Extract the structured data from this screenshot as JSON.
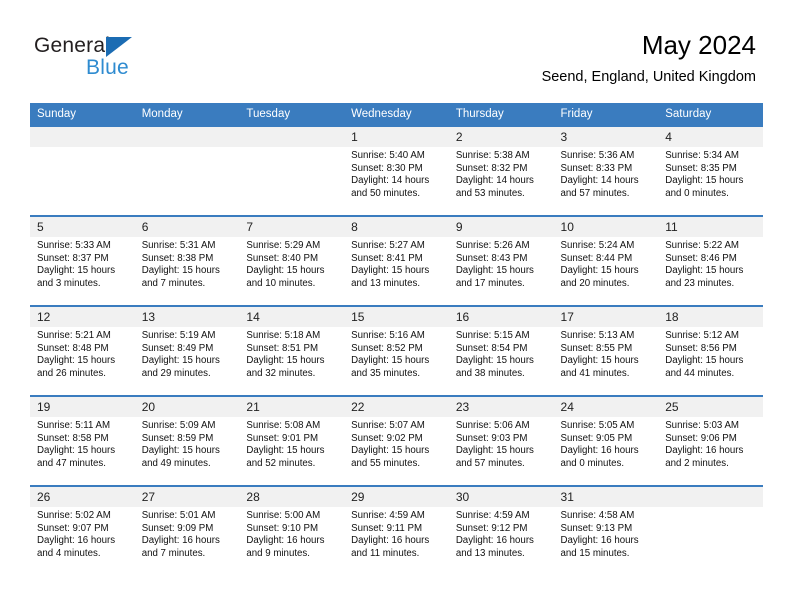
{
  "brand": {
    "name_dark": "General",
    "name_blue": "Blue",
    "accent_blue": "#2e8bd0",
    "triangle_blue": "#1b6cb3"
  },
  "header": {
    "title": "May 2024",
    "subtitle": "Seend, England, United Kingdom"
  },
  "colors": {
    "header_row_bg": "#3a7cbf",
    "daynum_bg": "#f1f1f1",
    "page_bg": "#ffffff",
    "text": "#000000"
  },
  "weekday_headers": [
    "Sunday",
    "Monday",
    "Tuesday",
    "Wednesday",
    "Thursday",
    "Friday",
    "Saturday"
  ],
  "weeks": [
    {
      "days": [
        {
          "num": "",
          "empty": true,
          "sunrise": "",
          "sunset": "",
          "daylight_1": "",
          "daylight_2": ""
        },
        {
          "num": "",
          "empty": true,
          "sunrise": "",
          "sunset": "",
          "daylight_1": "",
          "daylight_2": ""
        },
        {
          "num": "",
          "empty": true,
          "sunrise": "",
          "sunset": "",
          "daylight_1": "",
          "daylight_2": ""
        },
        {
          "num": "1",
          "empty": false,
          "sunrise": "Sunrise: 5:40 AM",
          "sunset": "Sunset: 8:30 PM",
          "daylight_1": "Daylight: 14 hours",
          "daylight_2": "and 50 minutes."
        },
        {
          "num": "2",
          "empty": false,
          "sunrise": "Sunrise: 5:38 AM",
          "sunset": "Sunset: 8:32 PM",
          "daylight_1": "Daylight: 14 hours",
          "daylight_2": "and 53 minutes."
        },
        {
          "num": "3",
          "empty": false,
          "sunrise": "Sunrise: 5:36 AM",
          "sunset": "Sunset: 8:33 PM",
          "daylight_1": "Daylight: 14 hours",
          "daylight_2": "and 57 minutes."
        },
        {
          "num": "4",
          "empty": false,
          "sunrise": "Sunrise: 5:34 AM",
          "sunset": "Sunset: 8:35 PM",
          "daylight_1": "Daylight: 15 hours",
          "daylight_2": "and 0 minutes."
        }
      ]
    },
    {
      "days": [
        {
          "num": "5",
          "empty": false,
          "sunrise": "Sunrise: 5:33 AM",
          "sunset": "Sunset: 8:37 PM",
          "daylight_1": "Daylight: 15 hours",
          "daylight_2": "and 3 minutes."
        },
        {
          "num": "6",
          "empty": false,
          "sunrise": "Sunrise: 5:31 AM",
          "sunset": "Sunset: 8:38 PM",
          "daylight_1": "Daylight: 15 hours",
          "daylight_2": "and 7 minutes."
        },
        {
          "num": "7",
          "empty": false,
          "sunrise": "Sunrise: 5:29 AM",
          "sunset": "Sunset: 8:40 PM",
          "daylight_1": "Daylight: 15 hours",
          "daylight_2": "and 10 minutes."
        },
        {
          "num": "8",
          "empty": false,
          "sunrise": "Sunrise: 5:27 AM",
          "sunset": "Sunset: 8:41 PM",
          "daylight_1": "Daylight: 15 hours",
          "daylight_2": "and 13 minutes."
        },
        {
          "num": "9",
          "empty": false,
          "sunrise": "Sunrise: 5:26 AM",
          "sunset": "Sunset: 8:43 PM",
          "daylight_1": "Daylight: 15 hours",
          "daylight_2": "and 17 minutes."
        },
        {
          "num": "10",
          "empty": false,
          "sunrise": "Sunrise: 5:24 AM",
          "sunset": "Sunset: 8:44 PM",
          "daylight_1": "Daylight: 15 hours",
          "daylight_2": "and 20 minutes."
        },
        {
          "num": "11",
          "empty": false,
          "sunrise": "Sunrise: 5:22 AM",
          "sunset": "Sunset: 8:46 PM",
          "daylight_1": "Daylight: 15 hours",
          "daylight_2": "and 23 minutes."
        }
      ]
    },
    {
      "days": [
        {
          "num": "12",
          "empty": false,
          "sunrise": "Sunrise: 5:21 AM",
          "sunset": "Sunset: 8:48 PM",
          "daylight_1": "Daylight: 15 hours",
          "daylight_2": "and 26 minutes."
        },
        {
          "num": "13",
          "empty": false,
          "sunrise": "Sunrise: 5:19 AM",
          "sunset": "Sunset: 8:49 PM",
          "daylight_1": "Daylight: 15 hours",
          "daylight_2": "and 29 minutes."
        },
        {
          "num": "14",
          "empty": false,
          "sunrise": "Sunrise: 5:18 AM",
          "sunset": "Sunset: 8:51 PM",
          "daylight_1": "Daylight: 15 hours",
          "daylight_2": "and 32 minutes."
        },
        {
          "num": "15",
          "empty": false,
          "sunrise": "Sunrise: 5:16 AM",
          "sunset": "Sunset: 8:52 PM",
          "daylight_1": "Daylight: 15 hours",
          "daylight_2": "and 35 minutes."
        },
        {
          "num": "16",
          "empty": false,
          "sunrise": "Sunrise: 5:15 AM",
          "sunset": "Sunset: 8:54 PM",
          "daylight_1": "Daylight: 15 hours",
          "daylight_2": "and 38 minutes."
        },
        {
          "num": "17",
          "empty": false,
          "sunrise": "Sunrise: 5:13 AM",
          "sunset": "Sunset: 8:55 PM",
          "daylight_1": "Daylight: 15 hours",
          "daylight_2": "and 41 minutes."
        },
        {
          "num": "18",
          "empty": false,
          "sunrise": "Sunrise: 5:12 AM",
          "sunset": "Sunset: 8:56 PM",
          "daylight_1": "Daylight: 15 hours",
          "daylight_2": "and 44 minutes."
        }
      ]
    },
    {
      "days": [
        {
          "num": "19",
          "empty": false,
          "sunrise": "Sunrise: 5:11 AM",
          "sunset": "Sunset: 8:58 PM",
          "daylight_1": "Daylight: 15 hours",
          "daylight_2": "and 47 minutes."
        },
        {
          "num": "20",
          "empty": false,
          "sunrise": "Sunrise: 5:09 AM",
          "sunset": "Sunset: 8:59 PM",
          "daylight_1": "Daylight: 15 hours",
          "daylight_2": "and 49 minutes."
        },
        {
          "num": "21",
          "empty": false,
          "sunrise": "Sunrise: 5:08 AM",
          "sunset": "Sunset: 9:01 PM",
          "daylight_1": "Daylight: 15 hours",
          "daylight_2": "and 52 minutes."
        },
        {
          "num": "22",
          "empty": false,
          "sunrise": "Sunrise: 5:07 AM",
          "sunset": "Sunset: 9:02 PM",
          "daylight_1": "Daylight: 15 hours",
          "daylight_2": "and 55 minutes."
        },
        {
          "num": "23",
          "empty": false,
          "sunrise": "Sunrise: 5:06 AM",
          "sunset": "Sunset: 9:03 PM",
          "daylight_1": "Daylight: 15 hours",
          "daylight_2": "and 57 minutes."
        },
        {
          "num": "24",
          "empty": false,
          "sunrise": "Sunrise: 5:05 AM",
          "sunset": "Sunset: 9:05 PM",
          "daylight_1": "Daylight: 16 hours",
          "daylight_2": "and 0 minutes."
        },
        {
          "num": "25",
          "empty": false,
          "sunrise": "Sunrise: 5:03 AM",
          "sunset": "Sunset: 9:06 PM",
          "daylight_1": "Daylight: 16 hours",
          "daylight_2": "and 2 minutes."
        }
      ]
    },
    {
      "days": [
        {
          "num": "26",
          "empty": false,
          "sunrise": "Sunrise: 5:02 AM",
          "sunset": "Sunset: 9:07 PM",
          "daylight_1": "Daylight: 16 hours",
          "daylight_2": "and 4 minutes."
        },
        {
          "num": "27",
          "empty": false,
          "sunrise": "Sunrise: 5:01 AM",
          "sunset": "Sunset: 9:09 PM",
          "daylight_1": "Daylight: 16 hours",
          "daylight_2": "and 7 minutes."
        },
        {
          "num": "28",
          "empty": false,
          "sunrise": "Sunrise: 5:00 AM",
          "sunset": "Sunset: 9:10 PM",
          "daylight_1": "Daylight: 16 hours",
          "daylight_2": "and 9 minutes."
        },
        {
          "num": "29",
          "empty": false,
          "sunrise": "Sunrise: 4:59 AM",
          "sunset": "Sunset: 9:11 PM",
          "daylight_1": "Daylight: 16 hours",
          "daylight_2": "and 11 minutes."
        },
        {
          "num": "30",
          "empty": false,
          "sunrise": "Sunrise: 4:59 AM",
          "sunset": "Sunset: 9:12 PM",
          "daylight_1": "Daylight: 16 hours",
          "daylight_2": "and 13 minutes."
        },
        {
          "num": "31",
          "empty": false,
          "sunrise": "Sunrise: 4:58 AM",
          "sunset": "Sunset: 9:13 PM",
          "daylight_1": "Daylight: 16 hours",
          "daylight_2": "and 15 minutes."
        },
        {
          "num": "",
          "empty": true,
          "sunrise": "",
          "sunset": "",
          "daylight_1": "",
          "daylight_2": ""
        }
      ]
    }
  ]
}
